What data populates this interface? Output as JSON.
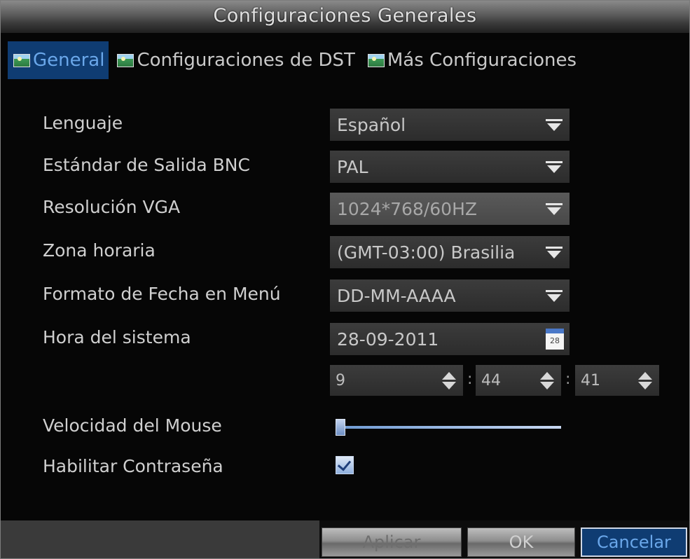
{
  "window": {
    "title": "Configuraciones Generales"
  },
  "tabs": [
    {
      "label": "General",
      "icon": "landscape-icon",
      "active": true
    },
    {
      "label": "Configuraciones de DST",
      "icon": "landscape-icon",
      "active": false
    },
    {
      "label": "Más Configuraciones",
      "icon": "landscape-icon",
      "active": false
    }
  ],
  "form": {
    "language": {
      "label": "Lenguaje",
      "value": "Español"
    },
    "bnc_output": {
      "label": "Estándar de Salida BNC",
      "value": "PAL"
    },
    "vga_resolution": {
      "label": "Resolución VGA",
      "value": "1024*768/60HZ"
    },
    "time_zone": {
      "label": "Zona horaria",
      "value": "(GMT-03:00) Brasilia"
    },
    "date_format": {
      "label": "Formato de Fecha en Menú",
      "value": "DD-MM-AAAA"
    },
    "system_time": {
      "label": "Hora del sistema",
      "date": "28-09-2011",
      "calendar_day": "28",
      "hour": "9",
      "minute": "44",
      "second": "41",
      "separator": ":"
    },
    "mouse_speed": {
      "label": "Velocidad del Mouse",
      "level": 0
    },
    "enable_password": {
      "label": "Habilitar Contraseña",
      "checked": true
    }
  },
  "buttons": {
    "apply": "Aplicar",
    "ok": "OK",
    "cancel": "Cancelar"
  },
  "colors": {
    "accent": "#0f3c72",
    "accent_text": "#6aa7ea",
    "background": "#060606"
  }
}
